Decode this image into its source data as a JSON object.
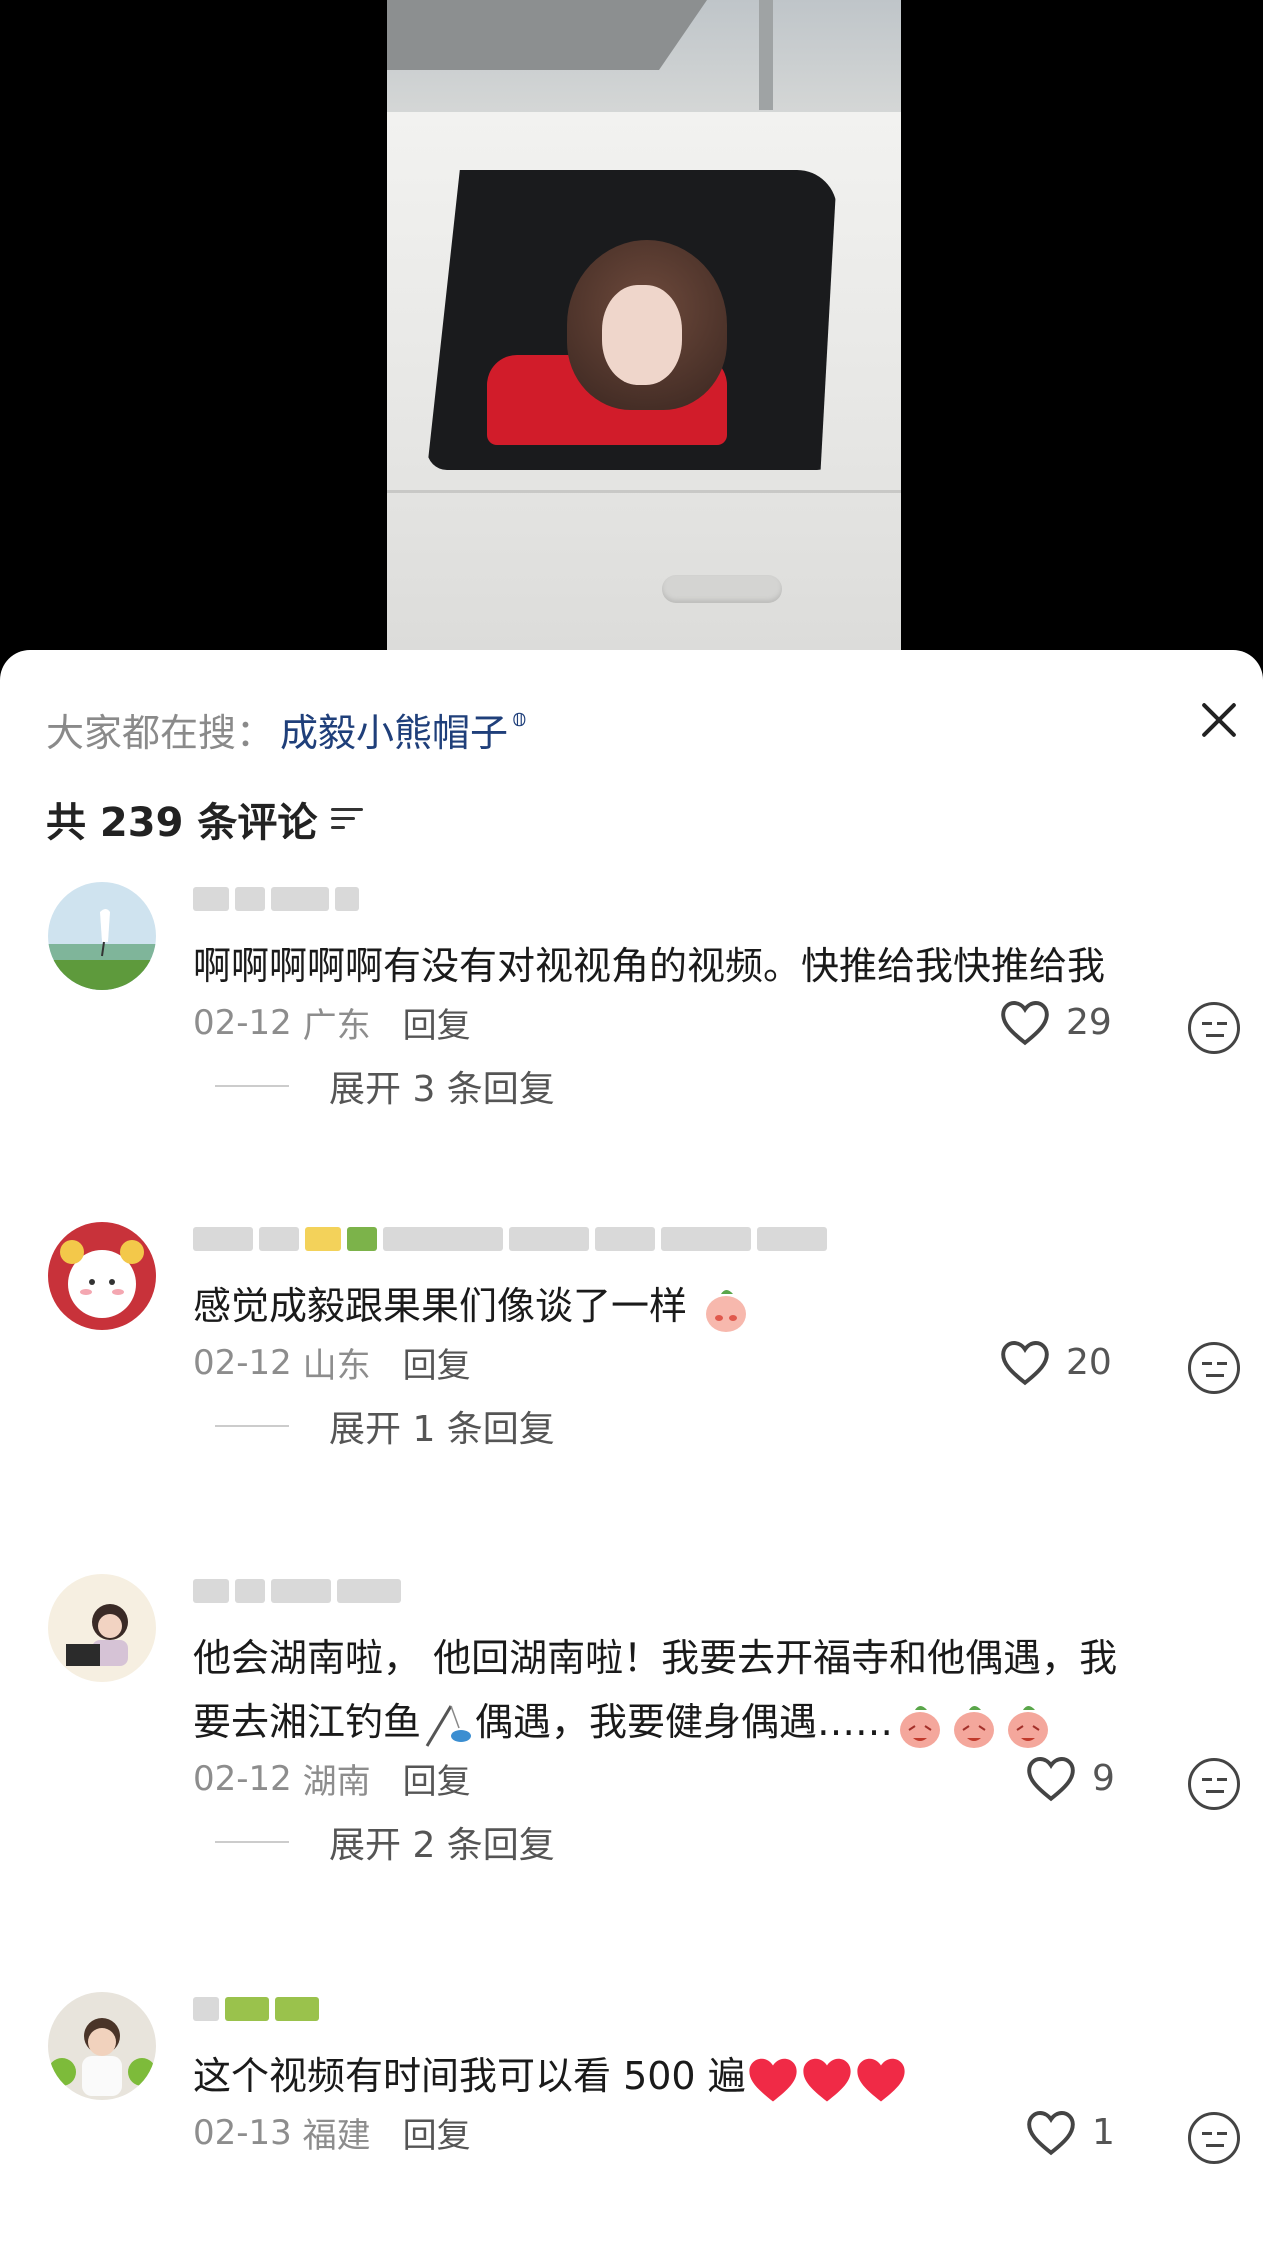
{
  "search": {
    "label": "大家都在搜：",
    "term": "成毅小熊帽子"
  },
  "comments_header": {
    "count_text": "共 239 条评论"
  },
  "comments": [
    {
      "text": "啊啊啊啊啊有没有对视视角的视频。快推给我快推给我",
      "date": "02-12",
      "location": "广东",
      "reply_label": "回复",
      "likes": "29",
      "expand_label": "展开 3 条回复"
    },
    {
      "text": "感觉成毅跟果果们像谈了一样",
      "date": "02-12",
      "location": "山东",
      "reply_label": "回复",
      "likes": "20",
      "expand_label": "展开 1 条回复"
    },
    {
      "text_line1": "他会湖南啦， 他回湖南啦！我要去开福寺和他偶遇，我",
      "text_line2": "要去湘江钓鱼",
      "text_line2b": "偶遇，我要健身偶遇……",
      "date": "02-12",
      "location": "湖南",
      "reply_label": "回复",
      "likes": "9",
      "expand_label": "展开 2 条回复"
    },
    {
      "text": "这个视频有时间我可以看 500 遍",
      "date": "02-13",
      "location": "福建",
      "reply_label": "回复",
      "likes": "1"
    }
  ],
  "colors": {
    "search_term": "#1f3f7a",
    "heart_emoji": "#f02a46"
  }
}
